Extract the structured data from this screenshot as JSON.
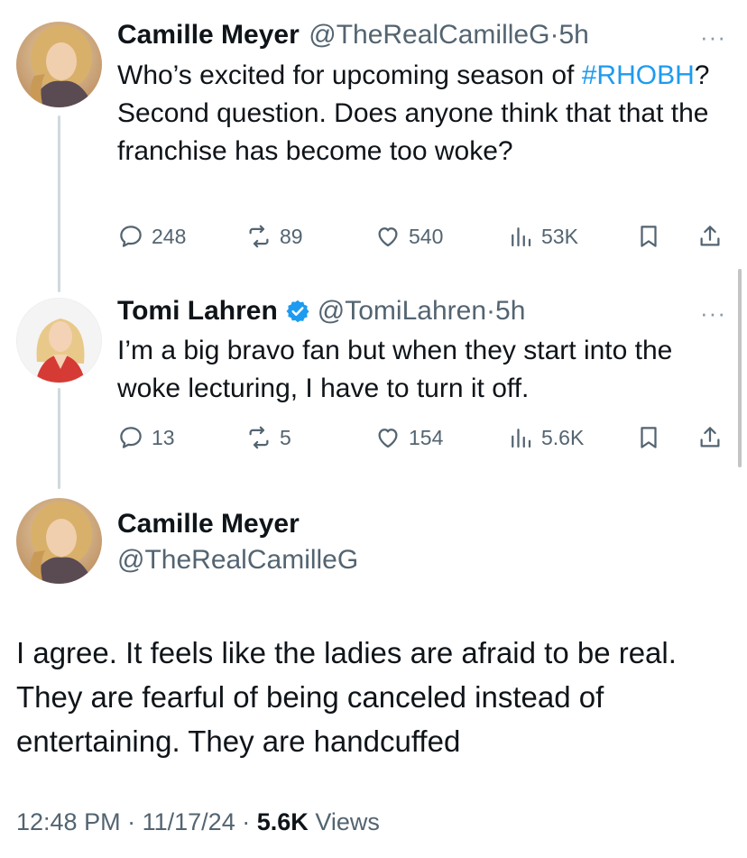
{
  "tweets": [
    {
      "author_name": "Camille Meyer",
      "author_handle": "@TheRealCamilleG",
      "time": "5h",
      "text_pre": "Who’s excited for upcoming season of",
      "hashtag": "#RHOBH",
      "text_post": "? Second question. Does anyone think that that the franchise has become too woke?",
      "replies": "248",
      "reposts": "89",
      "likes": "540",
      "views": "53K"
    },
    {
      "author_name": "Tomi Lahren",
      "author_handle": "@TomiLahren",
      "time": "5h",
      "verified": true,
      "text": "I’m a big bravo fan but when they start into the woke lecturing, I have to turn it off.",
      "replies": "13",
      "reposts": "5",
      "likes": "154",
      "views": "5.6K"
    }
  ],
  "main_tweet": {
    "author_name": "Camille Meyer",
    "author_handle": "@TheRealCamilleG",
    "text": "I agree. It feels like the ladies are afraid to be real. They are fearful of being canceled instead of entertaining. They are handcuffed",
    "time": "12:48 PM",
    "date": "11/17/24",
    "views_count": "5.6K",
    "views_label": "Views"
  },
  "separator": "·",
  "more_glyph": "···",
  "colors": {
    "accent": "#1d9bf0",
    "text": "#0f1419",
    "muted": "#536471",
    "thread_line": "#cfd9de"
  },
  "icons": [
    "reply-icon",
    "repost-icon",
    "like-icon",
    "views-icon",
    "bookmark-icon",
    "share-icon",
    "verified-badge-icon",
    "more-icon"
  ]
}
